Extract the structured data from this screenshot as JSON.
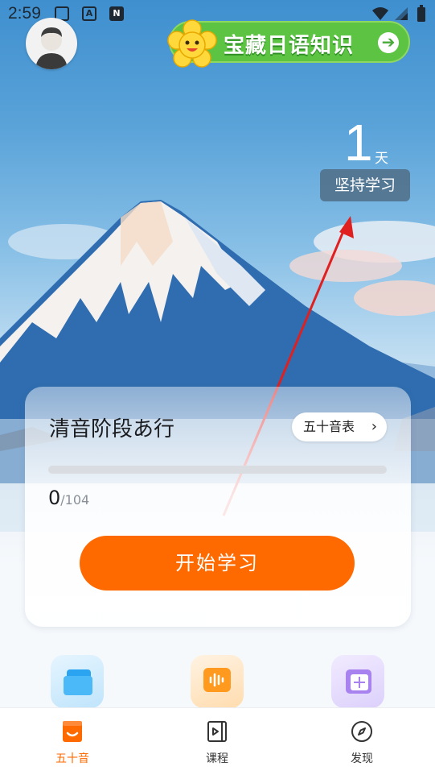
{
  "status_bar": {
    "time": "2:59"
  },
  "banner": {
    "title": "宝藏日语知识",
    "arrow": "➔"
  },
  "streak": {
    "days": "1",
    "unit": "天",
    "label": "坚持学习"
  },
  "card": {
    "stage_title": "清音阶段あ行",
    "chart_button": "五十音表",
    "chevron": "›",
    "progress_done": "0",
    "progress_total": "/104",
    "progress_fraction": 0,
    "start_button": "开始学习"
  },
  "features": [
    {
      "icon": "folder-icon"
    },
    {
      "icon": "voice-message-icon"
    },
    {
      "icon": "card-grid-icon"
    }
  ],
  "tabs": [
    {
      "label": "五十音",
      "icon": "book-smile-icon",
      "active": true
    },
    {
      "label": "课程",
      "icon": "video-course-icon",
      "active": false
    },
    {
      "label": "发现",
      "icon": "compass-icon",
      "active": false
    }
  ],
  "colors": {
    "accent": "#ff6a00",
    "banner_green": "#5cc442",
    "tab_inactive": "#333333"
  }
}
